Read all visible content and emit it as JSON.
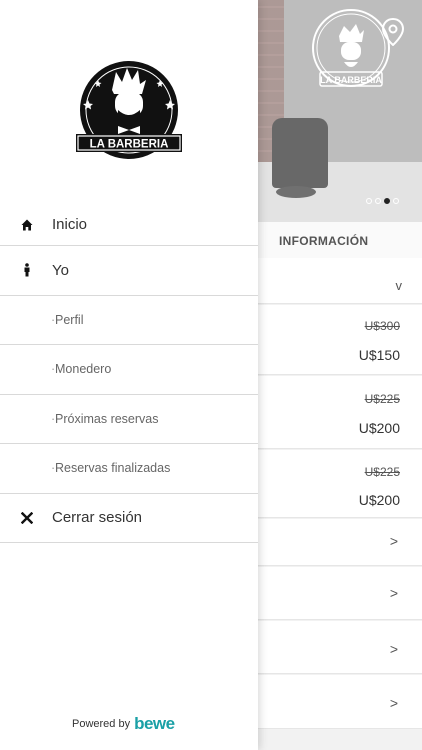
{
  "drawer": {
    "logo_text": "LA BARBERIA",
    "menu": [
      {
        "label": "Inicio",
        "icon": "home-icon"
      },
      {
        "label": "Yo",
        "icon": "person-icon"
      },
      {
        "label": "Perfil"
      },
      {
        "label": "Monedero"
      },
      {
        "label": "Próximas reservas"
      },
      {
        "label": "Reservas finalizadas"
      },
      {
        "label": "Cerrar sesión",
        "icon": "close-icon"
      }
    ],
    "powered_by": "Powered by",
    "brand": "bewe"
  },
  "background": {
    "logo_text": "LA BARBERIA",
    "info_title": "INFORMACIÓN",
    "expand_glyph": "v",
    "services": [
      {
        "old_price": "U$300",
        "new_price": "U$150"
      },
      {
        "old_price": "U$225",
        "new_price": "U$200"
      },
      {
        "old_price": "U$225",
        "new_price": "U$200"
      }
    ],
    "chevron_glyph": ">",
    "carousel": {
      "count": 4,
      "active_index": 2
    }
  },
  "colors": {
    "brand": "#1aa0a6",
    "divider": "#d9d9d9"
  }
}
